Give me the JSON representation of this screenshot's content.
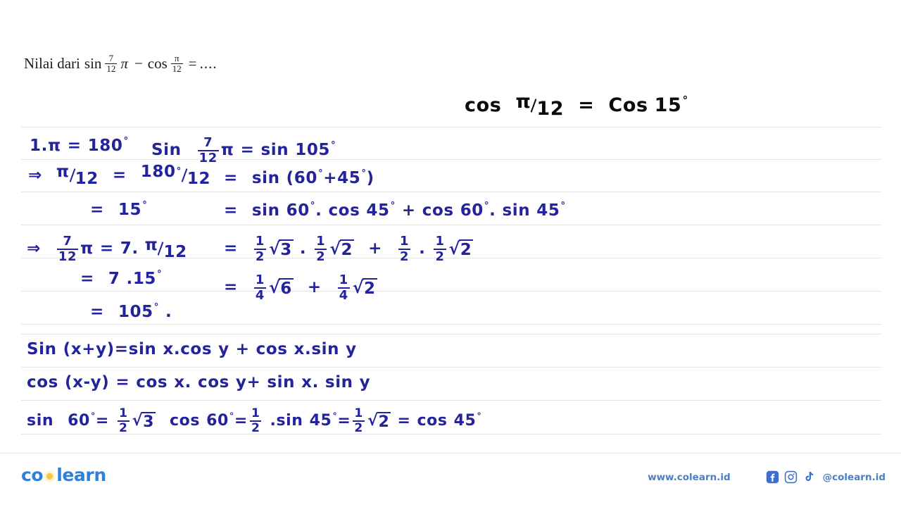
{
  "problem": {
    "lead": "Nilai dari",
    "fn1": "sin",
    "frac1_num": "7",
    "frac1_den": "12",
    "pi1": "π",
    "minus": "−",
    "fn2": "cos",
    "frac2_num": "π",
    "frac2_den": "12",
    "equals": "=",
    "dots": "...."
  },
  "notes": {
    "top_black": {
      "cos": "cos",
      "pi": "π",
      "twelve": "12",
      "equals": "=",
      "cos2": "Cos",
      "fifteen": "15",
      "deg": "°"
    },
    "left": [
      {
        "id": "l1",
        "text": "1.π = 180°"
      },
      {
        "id": "l2",
        "text": "⇒ π/12 = 180°/12"
      },
      {
        "id": "l3",
        "text": "= 15°"
      },
      {
        "id": "l4",
        "text": "⇒ 7/12 π = 7 . π/12"
      },
      {
        "id": "l5",
        "text": "= 7 . 15°"
      },
      {
        "id": "l6",
        "text": "= 105° ."
      }
    ],
    "right": [
      {
        "id": "r1",
        "text": "sin 7/12 π = sin 105°"
      },
      {
        "id": "r2",
        "text": "= sin (60° + 45°)"
      },
      {
        "id": "r3",
        "text": "= sin 60°. cos 45° + cos 60°. sin 45°"
      },
      {
        "id": "r4",
        "text": "= 1/2 √3 . 1/2 √2 + 1/2 . 1/2 √2"
      },
      {
        "id": "r5",
        "text": "= 1/4 √6 + 1/4 √2"
      }
    ],
    "formulas": [
      {
        "id": "f1",
        "text": "sin (x+y) = sin x.cos y + cos x.sin y"
      },
      {
        "id": "f2",
        "text": "cos (x-y) = cos x. cos y + sin x. sin y"
      },
      {
        "id": "f3",
        "text": "sin 60° = 1/2 √3  cos 60° = 1/2 , sin 45° = 1/2 √2 = cos 45°"
      }
    ],
    "tokens": {
      "one_dot_pi": "1.",
      "pi": "π",
      "eq": "=",
      "one_eighty": "180",
      "deg": "°",
      "implies": "⇒",
      "twelve": "12",
      "fifteen": "15",
      "seven": "7",
      "dot": ".",
      "one_zero_five": "105",
      "comma": ".",
      "sin": "sin",
      "Sin": "Sin",
      "cos": "cos",
      "Cos": "cos",
      "sixty": "60",
      "fortyfive": "45",
      "plus": "+",
      "minus": "-",
      "lparen": "(",
      "rparen": ")",
      "one": "1",
      "two": "2",
      "three": "3",
      "four": "4",
      "six": "6",
      "sqrt": "√",
      "x": "x",
      "y": "y"
    }
  },
  "footer": {
    "logo_part1": "co",
    "logo_part2": "learn",
    "website": "www.colearn.id",
    "handle": "@colearn.id",
    "social": [
      "facebook-icon",
      "instagram-icon",
      "tiktok-icon"
    ]
  },
  "colors": {
    "ink_blue": "#23239e",
    "ink_black": "#0b0b0b",
    "rule_gray": "#e3e3e3",
    "brand_blue": "#2f80d8",
    "logo_dot_yellow": "#f4c842",
    "footer_text": "#4b7fc4"
  }
}
